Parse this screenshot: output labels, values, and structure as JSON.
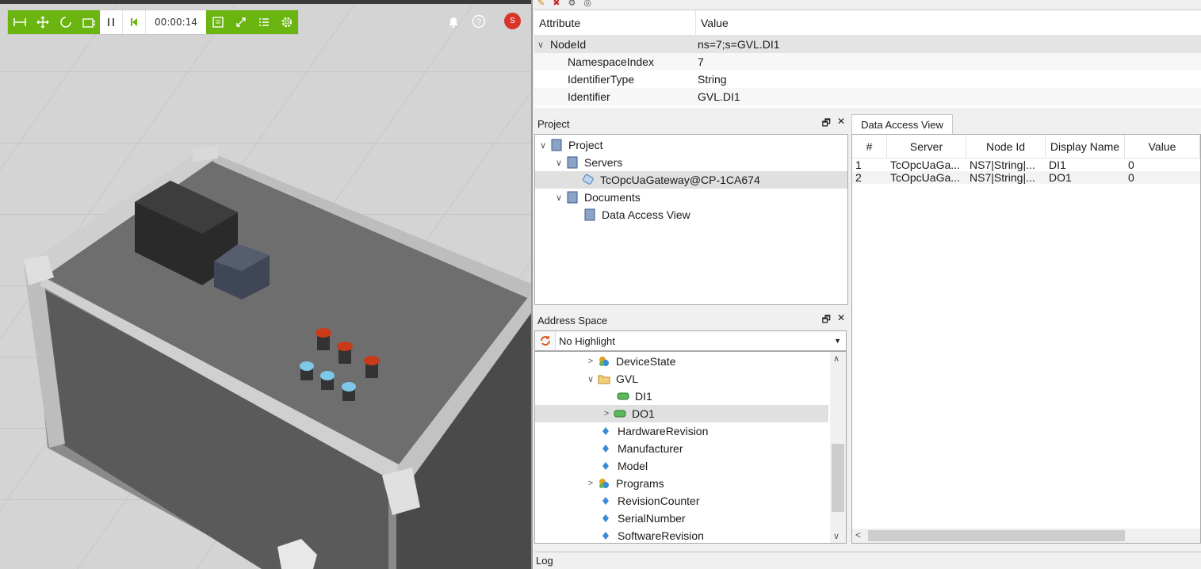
{
  "viewport": {
    "timer": "00:00:14",
    "user_initial": "S",
    "toolbar_left": [
      "fit-width-icon",
      "move-icon",
      "rotate-icon",
      "camera-icon"
    ],
    "toolbar_mid": [
      "pause-icon",
      "step-back-icon"
    ],
    "toolbar_right": [
      "frame-icon",
      "link-icon",
      "list-icon",
      "gear-icon"
    ],
    "accent": "#6ab50f"
  },
  "attributes": {
    "header": {
      "attribute": "Attribute",
      "value": "Value"
    },
    "rows": [
      {
        "name": "NodeId",
        "value": "ns=7;s=GVL.DI1",
        "expanded": true,
        "level": 0
      },
      {
        "name": "NamespaceIndex",
        "value": "7",
        "level": 1
      },
      {
        "name": "IdentifierType",
        "value": "String",
        "level": 1
      },
      {
        "name": "Identifier",
        "value": "GVL.DI1",
        "level": 1
      }
    ]
  },
  "project": {
    "title": "Project",
    "tree": [
      {
        "label": "Project",
        "level": 0,
        "icon": "project-icon"
      },
      {
        "label": "Servers",
        "level": 1,
        "icon": "servers-icon"
      },
      {
        "label": "TcOpcUaGateway@CP-1CA674",
        "level": 2,
        "icon": "server-connection-icon"
      },
      {
        "label": "Documents",
        "level": 1,
        "icon": "documents-icon"
      },
      {
        "label": "Data Access View",
        "level": 2,
        "icon": "document-icon"
      }
    ]
  },
  "address_space": {
    "title": "Address Space",
    "filter": "No Highlight",
    "tree": [
      {
        "label": "DeviceState",
        "level": 0,
        "icon": "object-icon"
      },
      {
        "label": "GVL",
        "level": 0,
        "icon": "folder-icon"
      },
      {
        "label": "DI1",
        "level": 1,
        "icon": "variable-icon"
      },
      {
        "label": "DO1",
        "level": 1,
        "icon": "variable-icon"
      },
      {
        "label": "HardwareRevision",
        "level": 0,
        "icon": "property-icon"
      },
      {
        "label": "Manufacturer",
        "level": 0,
        "icon": "property-icon"
      },
      {
        "label": "Model",
        "level": 0,
        "icon": "property-icon"
      },
      {
        "label": "Programs",
        "level": 0,
        "icon": "object-icon"
      },
      {
        "label": "RevisionCounter",
        "level": 0,
        "icon": "property-icon"
      },
      {
        "label": "SerialNumber",
        "level": 0,
        "icon": "property-icon"
      },
      {
        "label": "SoftwareRevision",
        "level": 0,
        "icon": "property-icon"
      }
    ]
  },
  "data_access_view": {
    "tab": "Data Access View",
    "columns": [
      "#",
      "Server",
      "Node Id",
      "Display Name",
      "Value"
    ],
    "rows": [
      [
        "1",
        "TcOpcUaGa...",
        "NS7|String|...",
        "DI1",
        "0"
      ],
      [
        "2",
        "TcOpcUaGa...",
        "NS7|String|...",
        "DO1",
        "0"
      ]
    ]
  },
  "log": {
    "title": "Log"
  }
}
